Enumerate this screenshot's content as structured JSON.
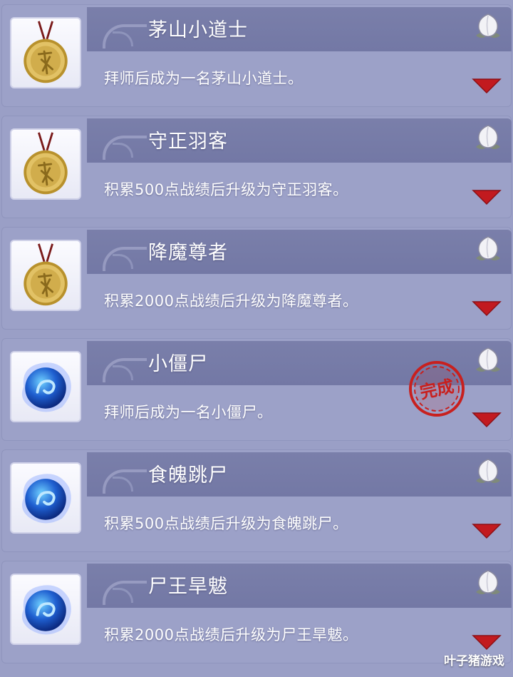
{
  "entries": [
    {
      "title": "茅山小道士",
      "desc": "拜师后成为一名茅山小道士。",
      "icon": "gold-medallion-icon",
      "completed": false
    },
    {
      "title": "守正羽客",
      "desc": "积累500点战绩后升级为守正羽客。",
      "icon": "gold-medallion-icon",
      "completed": false
    },
    {
      "title": "降魔尊者",
      "desc": "积累2000点战绩后升级为降魔尊者。",
      "icon": "gold-medallion-icon",
      "completed": false
    },
    {
      "title": "小僵尸",
      "desc": "拜师后成为一名小僵尸。",
      "icon": "blue-orb-icon",
      "completed": true
    },
    {
      "title": "食魄跳尸",
      "desc": "积累500点战绩后升级为食魄跳尸。",
      "icon": "blue-orb-icon",
      "completed": false
    },
    {
      "title": "尸王旱魃",
      "desc": "积累2000点战绩后升级为尸王旱魃。",
      "icon": "blue-orb-icon",
      "completed": false
    }
  ],
  "stamp": {
    "text": "完成",
    "color": "#c8201e"
  },
  "watermark": "叶子猪游戏",
  "colors": {
    "background": "#9a9fc6",
    "title_band": "#7378a5",
    "arrow": "#c21a1f"
  }
}
